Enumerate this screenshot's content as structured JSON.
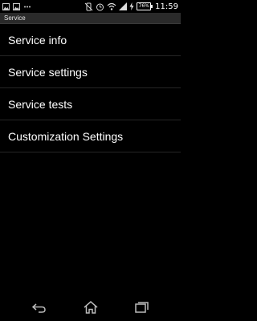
{
  "status_bar": {
    "time": "11:59",
    "battery_percent": "76%",
    "icons": [
      "image-icon",
      "image-icon",
      "dots-icon",
      "vibrate-off-icon",
      "alarm-icon",
      "wifi-icon",
      "signal-icon",
      "charging-icon",
      "battery-icon"
    ]
  },
  "action_bar": {
    "title": "Service"
  },
  "menu": {
    "items": [
      {
        "label": "Service info"
      },
      {
        "label": "Service settings"
      },
      {
        "label": "Service tests"
      },
      {
        "label": "Customization Settings"
      }
    ]
  },
  "nav_bar": {
    "icons": [
      "back-icon",
      "home-icon",
      "recents-icon"
    ]
  }
}
